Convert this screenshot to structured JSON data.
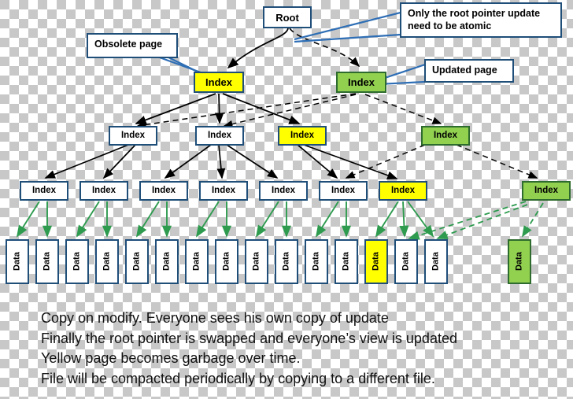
{
  "diagram": {
    "title": "Copy-on-modify B-tree page update",
    "colors": {
      "obsolete_yellow": "#FFFF00",
      "updated_green": "#92D050",
      "normal_white": "#FFFFFF",
      "border_blue": "#1F4E79",
      "green_arrow": "#2E9B4F",
      "black_arrow": "#000000"
    },
    "root": {
      "label": "Root"
    },
    "callouts": [
      {
        "name": "obsolete-page-callout",
        "text": "Obsolete page"
      },
      {
        "name": "root-pointer-callout",
        "line1": "Only the root pointer update",
        "line2": "need to be atomic"
      },
      {
        "name": "updated-page-callout",
        "text": "Updated page"
      }
    ],
    "level1": [
      {
        "label": "Index",
        "state": "obsolete"
      },
      {
        "label": "Index",
        "state": "updated"
      }
    ],
    "level2": [
      {
        "label": "Index",
        "state": "normal"
      },
      {
        "label": "Index",
        "state": "normal"
      },
      {
        "label": "Index",
        "state": "obsolete"
      },
      {
        "label": "Index",
        "state": "updated"
      }
    ],
    "level3": [
      {
        "label": "Index",
        "state": "normal"
      },
      {
        "label": "Index",
        "state": "normal"
      },
      {
        "label": "Index",
        "state": "normal"
      },
      {
        "label": "Index",
        "state": "normal"
      },
      {
        "label": "Index",
        "state": "normal"
      },
      {
        "label": "Index",
        "state": "normal"
      },
      {
        "label": "Index",
        "state": "obsolete"
      },
      {
        "label": "Index",
        "state": "updated"
      }
    ],
    "data_nodes": [
      {
        "label": "Data",
        "state": "normal"
      },
      {
        "label": "Data",
        "state": "normal"
      },
      {
        "label": "Data",
        "state": "normal"
      },
      {
        "label": "Data",
        "state": "normal"
      },
      {
        "label": "Data",
        "state": "normal"
      },
      {
        "label": "Data",
        "state": "normal"
      },
      {
        "label": "Data",
        "state": "normal"
      },
      {
        "label": "Data",
        "state": "normal"
      },
      {
        "label": "Data",
        "state": "normal"
      },
      {
        "label": "Data",
        "state": "normal"
      },
      {
        "label": "Data",
        "state": "normal"
      },
      {
        "label": "Data",
        "state": "normal"
      },
      {
        "label": "Data",
        "state": "obsolete"
      },
      {
        "label": "Data",
        "state": "normal"
      },
      {
        "label": "Data",
        "state": "normal"
      },
      {
        "label": "Data",
        "state": "updated"
      }
    ],
    "caption": {
      "line1": "Copy on modify.  Everyone sees his own copy of update",
      "line2": "Finally the root pointer is swapped and everyone’s view is updated",
      "line3": "Yellow page becomes garbage over time.",
      "line4": "File will be compacted periodically by copying to a different file."
    }
  }
}
